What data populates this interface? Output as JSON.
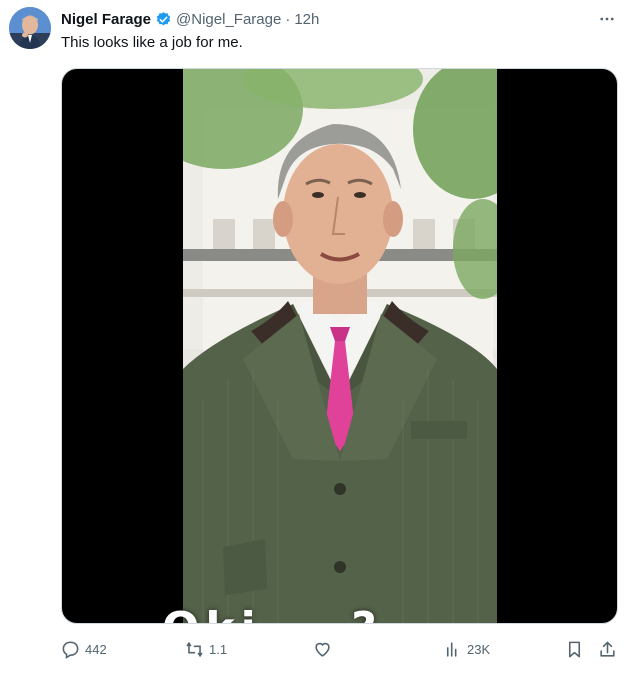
{
  "tweet": {
    "author_name": "Nigel Farage",
    "handle": "@Nigel_Farage",
    "separator": "·",
    "time": "12h",
    "text": "This looks like a job for me.",
    "verified": true
  },
  "media": {
    "caption": "Oki... ?"
  },
  "actions": {
    "replies": "442",
    "reposts": "1.1",
    "likes": "",
    "views": "23K"
  },
  "colors": {
    "verified": "#1d9bf0",
    "muted_text": "#536471",
    "tie": "#e0429a",
    "jacket": "#55624a"
  },
  "icons": {
    "more": "more-horizontal-icon",
    "reply": "reply-icon",
    "repost": "repost-icon",
    "like": "like-icon",
    "views": "views-icon",
    "bookmark": "bookmark-icon",
    "share": "share-icon"
  }
}
